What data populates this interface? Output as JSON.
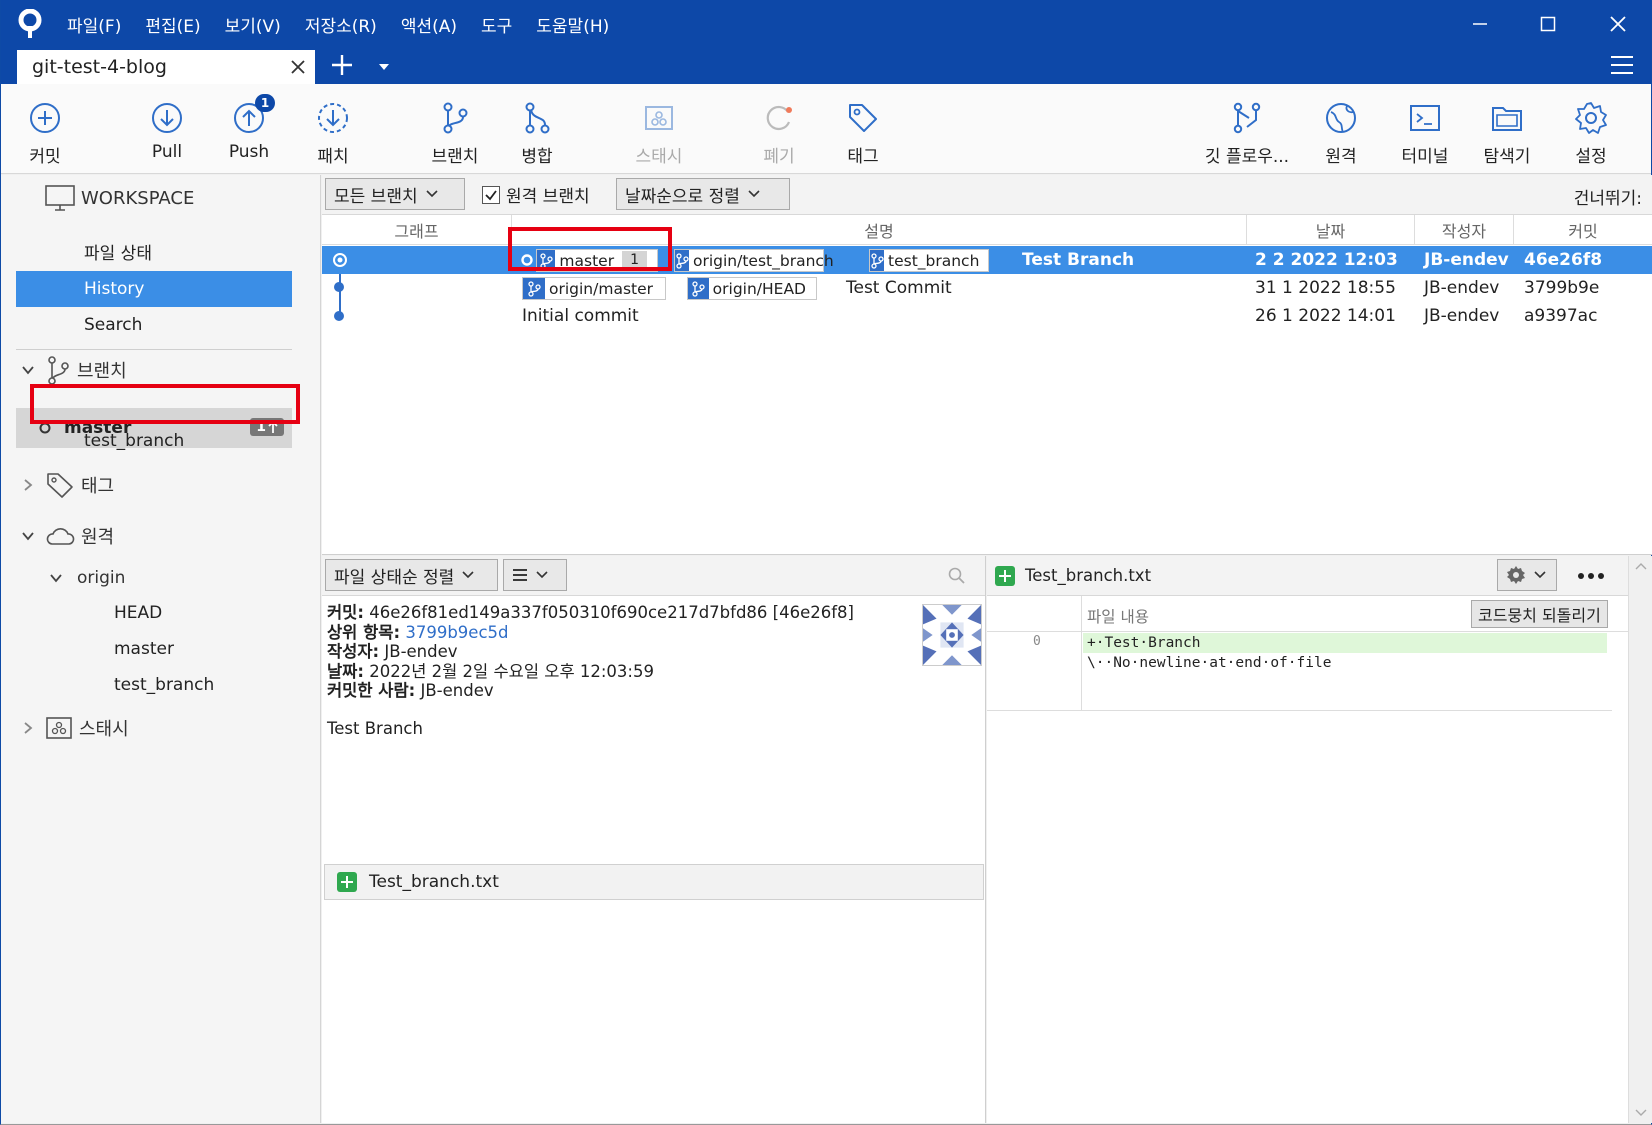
{
  "menu": [
    "파일(F)",
    "편집(E)",
    "보기(V)",
    "저장소(R)",
    "액션(A)",
    "도구",
    "도움말(H)"
  ],
  "tab": {
    "title": "git-test-4-blog"
  },
  "toolbar": {
    "commit": "커밋",
    "pull": "Pull",
    "push": "Push",
    "push_badge": "1",
    "patch": "패치",
    "branch": "브랜치",
    "merge": "병합",
    "stash": "스태시",
    "discard": "폐기",
    "tag": "태그",
    "gitflow": "깃 플로우...",
    "remote": "원격",
    "terminal": "터미널",
    "explorer": "탐색기",
    "settings": "설정"
  },
  "sidebar": {
    "workspace": "WORKSPACE",
    "file_status": "파일 상태",
    "history": "History",
    "search": "Search",
    "branches": "브랜치",
    "master": "master",
    "master_badge": "1",
    "test_branch": "test_branch",
    "tags": "태그",
    "remotes": "원격",
    "origin": "origin",
    "origin_head": "HEAD",
    "origin_master": "master",
    "origin_test_branch": "test_branch",
    "stash": "스태시"
  },
  "filter": {
    "branches": "모든 브랜치",
    "remote_branches": "원격 브랜치",
    "sort": "날짜순으로 정렬",
    "skip": "건너뛰기:"
  },
  "columns": {
    "graph": "그래프",
    "desc": "설명",
    "date": "날짜",
    "author": "작성자",
    "commit": "커밋"
  },
  "commits": [
    {
      "refs": [
        "master",
        "origin/test_branch",
        "test_branch"
      ],
      "ref_count": "1",
      "message": "Test Branch",
      "date": "2 2 2022 12:03",
      "author": "JB-endev",
      "hash": "46e26f8"
    },
    {
      "refs": [
        "origin/master",
        "origin/HEAD"
      ],
      "message": "Test Commit",
      "date": "31 1 2022 18:55",
      "author": "JB-endev",
      "hash": "3799b9e"
    },
    {
      "message": "Initial commit",
      "date": "26 1 2022 14:01",
      "author": "JB-endev",
      "hash": "a9397ac"
    }
  ],
  "details": {
    "sort": "파일 상태순 정렬",
    "commit_label": "커밋:",
    "commit_value": "46e26f81ed149a337f050310f690ce217d7bfd86 [46e26f8]",
    "parent_label": "상위 항목:",
    "parent_value": "3799b9ec5d",
    "author_label": "작성자:",
    "author_value": "JB-endev",
    "date_label": "날짜:",
    "date_value": "2022년 2월 2일 수요일 오후 12:03:59",
    "committer_label": "커밋한 사람:",
    "committer_value": "JB-endev",
    "message": "Test Branch",
    "file": "Test_branch.txt"
  },
  "diff": {
    "file": "Test_branch.txt",
    "header": "파일 내용",
    "revert": "코드뭉치 되돌리기",
    "line_no": "0",
    "lines": [
      "+·Test·Branch",
      "\\··No·newline·at·end·of·file"
    ]
  },
  "colors": {
    "brand": "#0d48a8",
    "selection": "#3b8ee6",
    "highlight": "#e60012"
  }
}
